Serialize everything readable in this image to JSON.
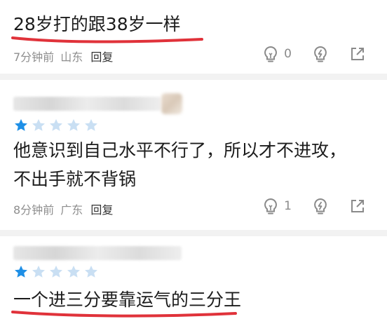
{
  "comments": [
    {
      "text": "28岁打的跟38岁一样",
      "meta": {
        "time": "7分钟前",
        "location": "山东",
        "reply_label": "回复"
      },
      "likes": "0"
    },
    {
      "rating": 1,
      "lines": [
        "他意识到自己水平不行了，所以才不进攻，",
        "不出手就不背锅"
      ],
      "meta": {
        "time": "8分钟前",
        "location": "广东",
        "reply_label": "回复"
      },
      "likes": "1"
    },
    {
      "rating": 1,
      "text": "一个进三分要靠运气的三分王"
    }
  ],
  "colors": {
    "star_filled": "#1e8fe6",
    "star_empty": "#c9dff3",
    "underline": "#e0323a",
    "icon": "#8a8a8a"
  },
  "icons": {
    "like": "lightbulb-icon",
    "dislike": "lightning-bulb-icon",
    "share": "share-arrow-icon",
    "rating": "star-icon"
  }
}
